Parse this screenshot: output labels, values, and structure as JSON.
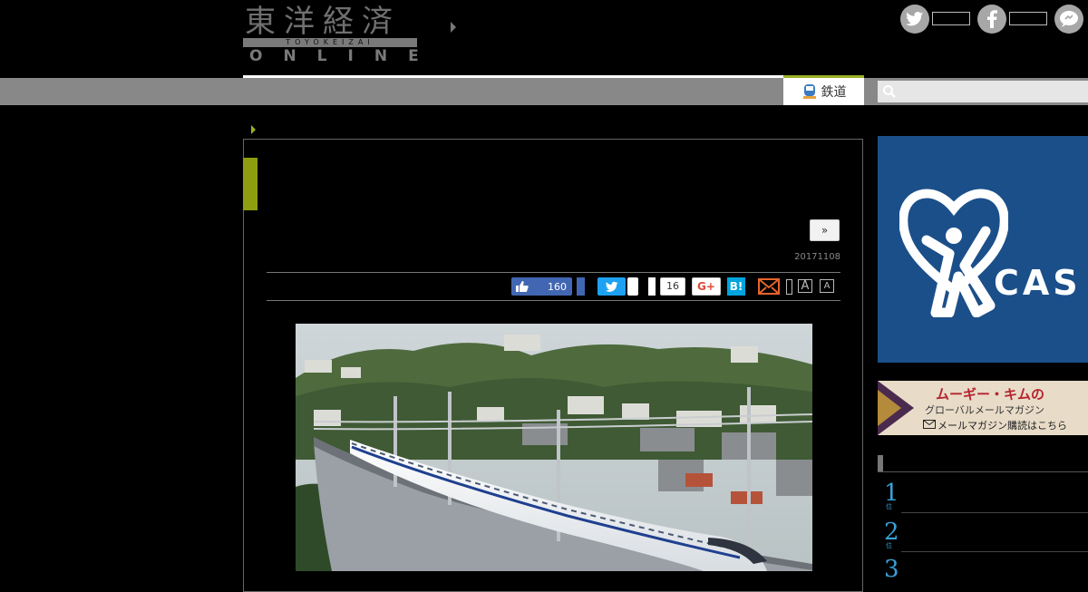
{
  "header": {
    "logo_kanji": "東洋経済",
    "logo_romaji": "TOYOKEIZAI",
    "logo_online": "ONLINE",
    "social": [
      {
        "name": "twitter-icon"
      },
      {
        "name": "facebook-icon"
      },
      {
        "name": "chat-icon"
      }
    ]
  },
  "nav": {
    "active_tab": "鉄道",
    "search": {
      "placeholder": ""
    }
  },
  "article": {
    "next_label": "»",
    "date": "20171108",
    "share": {
      "facebook_count": "160",
      "pocket_count": "16",
      "gplus_label": "G+",
      "hatena_label": "B!",
      "font_large": "A",
      "font_small": "A"
    }
  },
  "sidebar": {
    "ad_cas_text": "CAS",
    "ad_mm": {
      "title": "ムーギー・キムの",
      "subtitle": "グローバルメールマガジン",
      "link": "メールマガジン購読はこちら"
    },
    "ranking": [
      {
        "rank": "1",
        "suffix": "位"
      },
      {
        "rank": "2",
        "suffix": "位"
      },
      {
        "rank": "3",
        "suffix": "位"
      }
    ]
  },
  "colors": {
    "accent_green": "#9ab026",
    "facebook": "#4267b2",
    "twitter": "#1da1f2",
    "hatena": "#00a4de",
    "ranking_blue": "#3aa0d8"
  }
}
